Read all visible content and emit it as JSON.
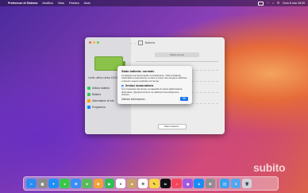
{
  "menubar": {
    "app_name": "Preferenze di Sistema",
    "items": [
      "Modifica",
      "Vista",
      "Finestra",
      "Aiuto"
    ],
    "clock": "Dom 8 mar 18:39"
  },
  "window": {
    "title": "Batteria",
    "segment_label": "Ultime 24 ore",
    "sidebar_status": "Livello ultimo carica 100%",
    "sidebar_items": [
      {
        "label": "Utilizzo batteria",
        "color": "#34c759"
      },
      {
        "label": "Batteria",
        "color": "#34c759"
      },
      {
        "label": "Alimentatore di rete",
        "color": "#ff9f0a"
      },
      {
        "label": "Programma",
        "color": "#0a84ff"
      }
    ],
    "health_button": "Stato batteria..."
  },
  "dialog": {
    "title": "Stato batteria: normale",
    "body": "La batteria sta funzionando correttamente. Tutte le batterie ricaricabili si esauriscono a mano a mano che vengono utilizzate e devono essere sostituite nel tempo.",
    "checkbox_label": "Gestisci durata batteria",
    "checkbox_checked": true,
    "checkbox_desc": "Con il passare del tempo, la capacità di carica della batteria diminuisce. Questa funzione ne rallenta l'invecchiamento chimico.",
    "link": "Ulteriori informazioni...",
    "ok_label": "OK"
  },
  "dock": {
    "apps": [
      {
        "name": "finder-icon",
        "glyph": "☺",
        "color": "#2a8cf0"
      },
      {
        "name": "launchpad-icon",
        "glyph": "▦",
        "color": "#8a8a8a"
      },
      {
        "name": "safari-icon",
        "glyph": "✦",
        "color": "#1f8ff5"
      },
      {
        "name": "messages-icon",
        "glyph": "●",
        "color": "#38c84a"
      },
      {
        "name": "mail-icon",
        "glyph": "✉",
        "color": "#3a8ef5"
      },
      {
        "name": "maps-icon",
        "glyph": "➤",
        "color": "#5bb85c"
      },
      {
        "name": "photos-icon",
        "glyph": "✿",
        "color": "#f0a23a"
      },
      {
        "name": "facetime-icon",
        "glyph": "▶",
        "color": "#2dbd52"
      },
      {
        "name": "calendar-icon",
        "glyph": "9",
        "color": "#ffffff"
      },
      {
        "name": "contacts-icon",
        "glyph": "☻",
        "color": "#c7a06a"
      },
      {
        "name": "reminders-icon",
        "glyph": "☰",
        "color": "#ffffff"
      },
      {
        "name": "notes-icon",
        "glyph": "✎",
        "color": "#f5d547"
      },
      {
        "name": "tv-icon",
        "glyph": "tv",
        "color": "#111111"
      },
      {
        "name": "music-icon",
        "glyph": "♫",
        "color": "#f4455c"
      },
      {
        "name": "podcasts-icon",
        "glyph": "◉",
        "color": "#a259e0"
      },
      {
        "name": "appstore-icon",
        "glyph": "A",
        "color": "#1a8cf5"
      },
      {
        "name": "settings-icon",
        "glyph": "⚙",
        "color": "#8e8e93"
      }
    ],
    "right": [
      {
        "name": "screenshot-icon",
        "glyph": "◫",
        "color": "#3aa0f0"
      },
      {
        "name": "downloads-icon",
        "glyph": "⇩",
        "color": "#55a6f0"
      },
      {
        "name": "trash-icon",
        "glyph": "🗑",
        "color": "#d0d4da"
      }
    ]
  },
  "watermark": "subito"
}
